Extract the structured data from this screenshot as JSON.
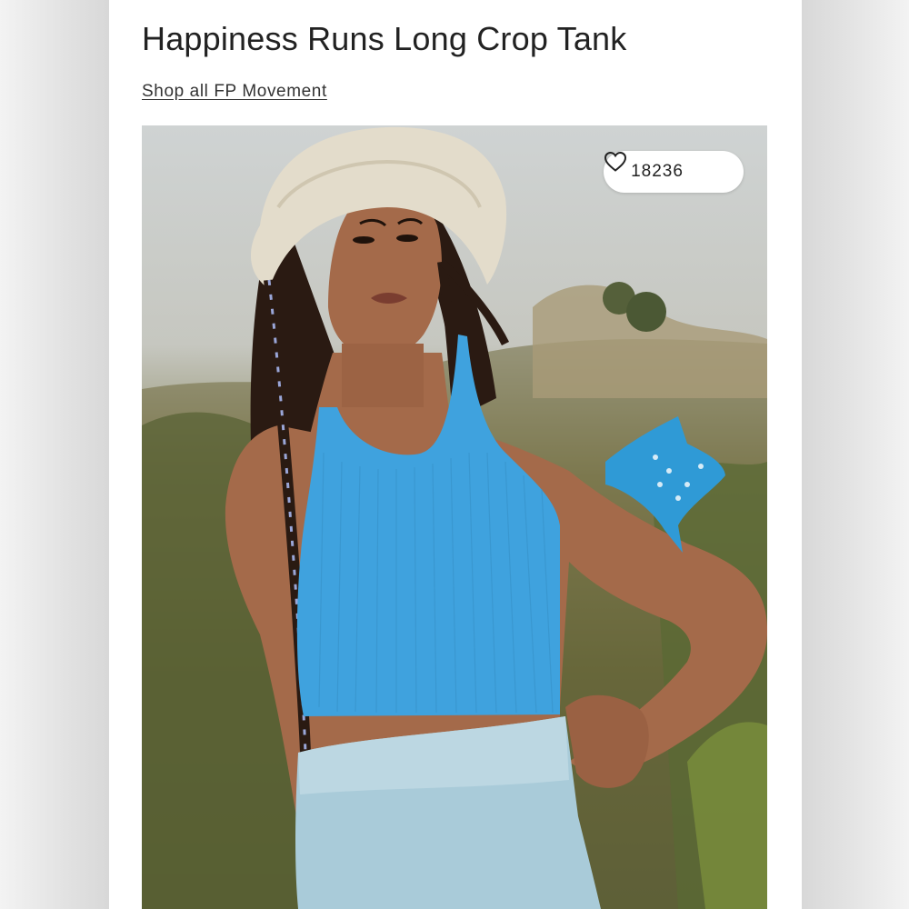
{
  "product": {
    "title": "Happiness Runs Long Crop Tank",
    "shop_link": "Shop all FP Movement"
  },
  "favorites": {
    "count": "18236",
    "icon": "heart-outline-icon"
  },
  "photo": {
    "alt": "Product image"
  },
  "colors": {
    "tank": "#3fa2de",
    "shorts": "#a9cbd9",
    "skin": "#a46a4a",
    "hat": "#e3dccb",
    "bandana": "#2f9ad6"
  }
}
